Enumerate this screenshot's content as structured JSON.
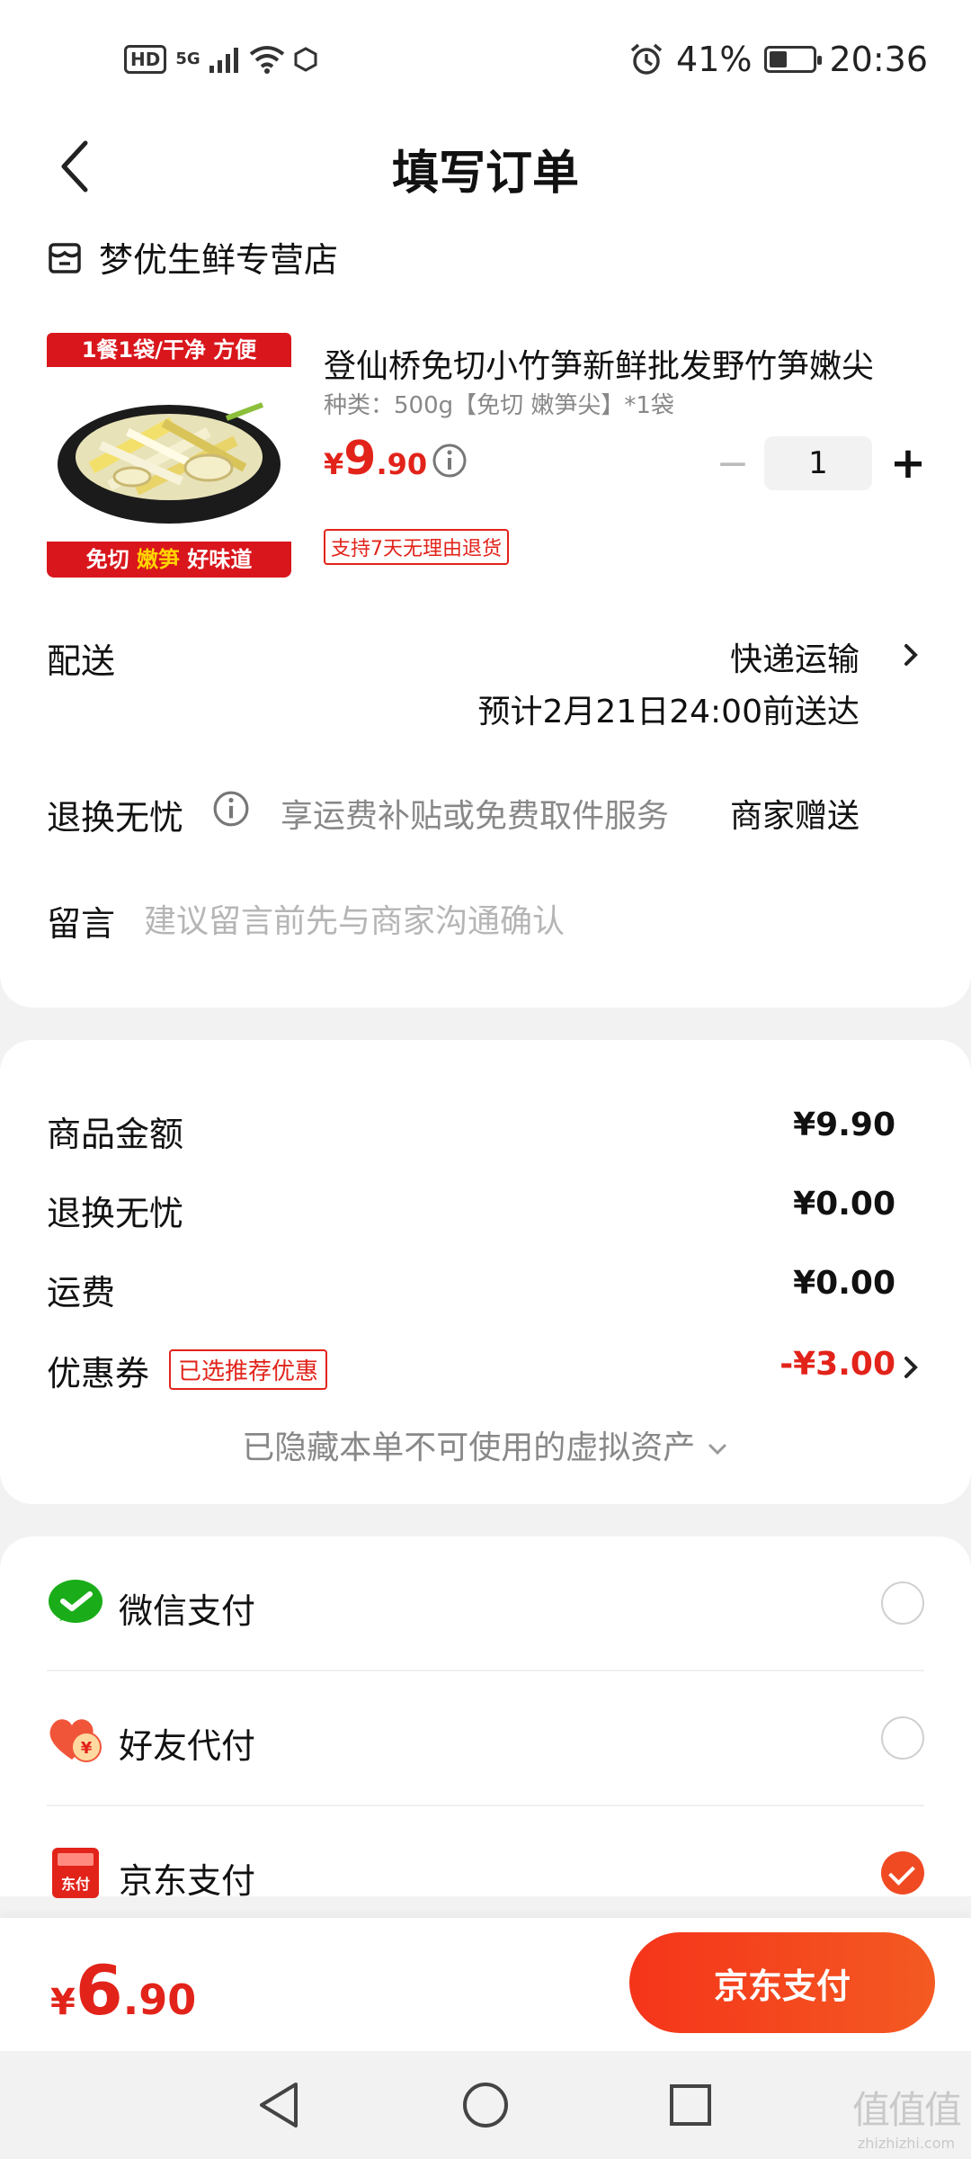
{
  "status_bar": {
    "hd": "HD",
    "network": "5G",
    "battery_percent": "41%",
    "battery_level": 0.41,
    "time": "20:36"
  },
  "header": {
    "title": "填写订单"
  },
  "shop": {
    "name": "梦优生鲜专营店"
  },
  "product": {
    "image_banner_top": "1餐1袋/干净 方便",
    "image_banner_bottom_a": "免切",
    "image_banner_bottom_b": "嫩笋",
    "image_banner_bottom_c": "好味道",
    "title": "登仙桥免切小竹笋新鲜批发野竹笋嫩尖",
    "spec": "种类：500g【免切 嫩笋尖】*1袋",
    "price_currency": "¥",
    "price_int": "9",
    "price_dec": ".90",
    "quantity": "1",
    "minus": "−",
    "plus": "+",
    "return_tag": "支持7天无理由退货"
  },
  "delivery": {
    "label": "配送",
    "method": "快递运输",
    "eta": "预计2月21日24:00前送达"
  },
  "return_service": {
    "label": "退换无忧",
    "desc": "享运费补贴或免费取件服务",
    "value": "商家赠送"
  },
  "message": {
    "label": "留言",
    "placeholder": "建议留言前先与商家沟通确认"
  },
  "amounts": {
    "goods_label": "商品金额",
    "goods_value": "¥9.90",
    "return_label": "退换无忧",
    "return_value": "¥0.00",
    "shipping_label": "运费",
    "shipping_value": "¥0.00",
    "coupon_label": "优惠券",
    "coupon_tag": "已选推荐优惠",
    "coupon_value": "-¥3.00",
    "hidden_assets": "已隐藏本单不可使用的虚拟资产"
  },
  "payment": {
    "options": [
      {
        "label": "微信支付",
        "icon": "wechat-pay-icon",
        "selected": false
      },
      {
        "label": "好友代付",
        "icon": "friend-pay-icon",
        "selected": false
      },
      {
        "label": "京东支付",
        "icon": "jd-pay-icon",
        "icon_text": "东付",
        "selected": true
      }
    ]
  },
  "bottom": {
    "total_currency": "¥",
    "total_int": "6",
    "total_dec": ".90",
    "pay_button": "京东支付"
  },
  "watermark": {
    "logo": "值值值",
    "text": "zhizhizhi.com"
  },
  "colors": {
    "accent": "#e2231a",
    "button": "#f4421f",
    "wechat": "#1aad19"
  }
}
